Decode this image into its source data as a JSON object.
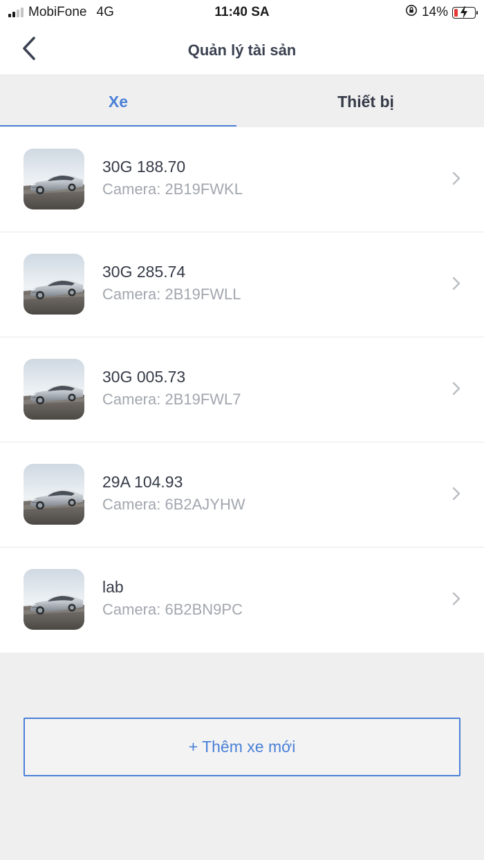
{
  "status_bar": {
    "carrier": "MobiFone",
    "network": "4G",
    "time": "11:40 SA",
    "battery_percent": "14%",
    "battery_level": 0.14,
    "signal_bars": 2
  },
  "nav": {
    "title": "Quản lý tài sản",
    "back_icon": "chevron-left-icon"
  },
  "tabs": [
    {
      "label": "Xe",
      "active": true
    },
    {
      "label": "Thiết bị",
      "active": false
    }
  ],
  "vehicles": [
    {
      "name": "30G 188.70",
      "camera": "Camera: 2B19FWKL"
    },
    {
      "name": "30G 285.74",
      "camera": "Camera: 2B19FWLL"
    },
    {
      "name": "30G 005.73",
      "camera": "Camera: 2B19FWL7"
    },
    {
      "name": "29A 104.93",
      "camera": "Camera: 6B2AJYHW"
    },
    {
      "name": "lab",
      "camera": "Camera: 6B2BN9PC"
    }
  ],
  "add_button": {
    "label": "+ Thêm xe mới"
  },
  "colors": {
    "accent": "#4a80d6",
    "battery_low": "#e53935",
    "background": "#efeff0"
  }
}
